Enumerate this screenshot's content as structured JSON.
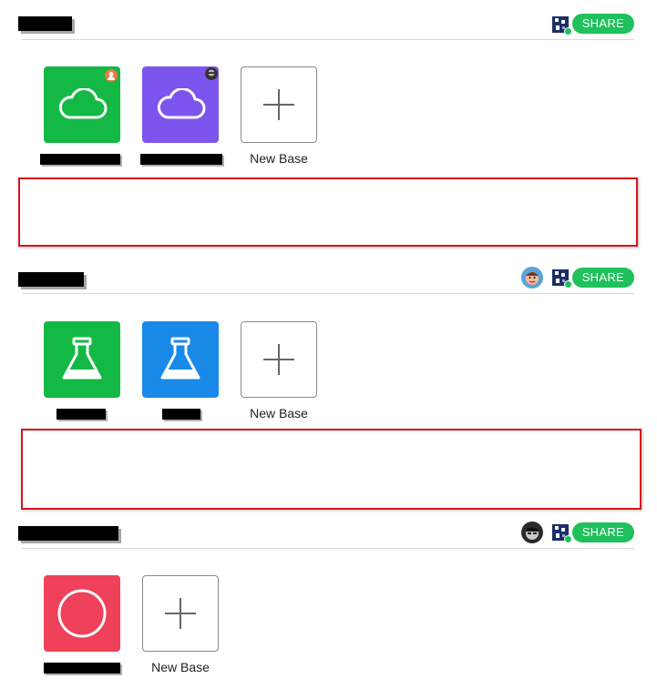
{
  "workspaces": [
    {
      "name": "",
      "share_label": "SHARE",
      "bases": [
        {
          "name": "",
          "color": "#14b845",
          "icon": "cloud-icon",
          "badge": "collaborator-badge"
        },
        {
          "name": "",
          "color": "#7c55ee",
          "icon": "cloud-icon",
          "badge": "collaborator-avatar"
        }
      ],
      "new_base_label": "New Base"
    },
    {
      "name": "",
      "share_label": "SHARE",
      "bases": [
        {
          "name": "",
          "color": "#14b845",
          "icon": "flask-icon"
        },
        {
          "name": "",
          "color": "#1a8ae8",
          "icon": "flask-icon"
        }
      ],
      "new_base_label": "New Base"
    },
    {
      "name": "",
      "share_label": "SHARE",
      "bases": [
        {
          "name": "",
          "color": "#f0415a",
          "icon": "circle-icon"
        }
      ],
      "new_base_label": "New Base"
    }
  ],
  "colors": {
    "share_button": "#20c05c",
    "highlight_border": "#d8141b",
    "redaction": "#000000"
  }
}
